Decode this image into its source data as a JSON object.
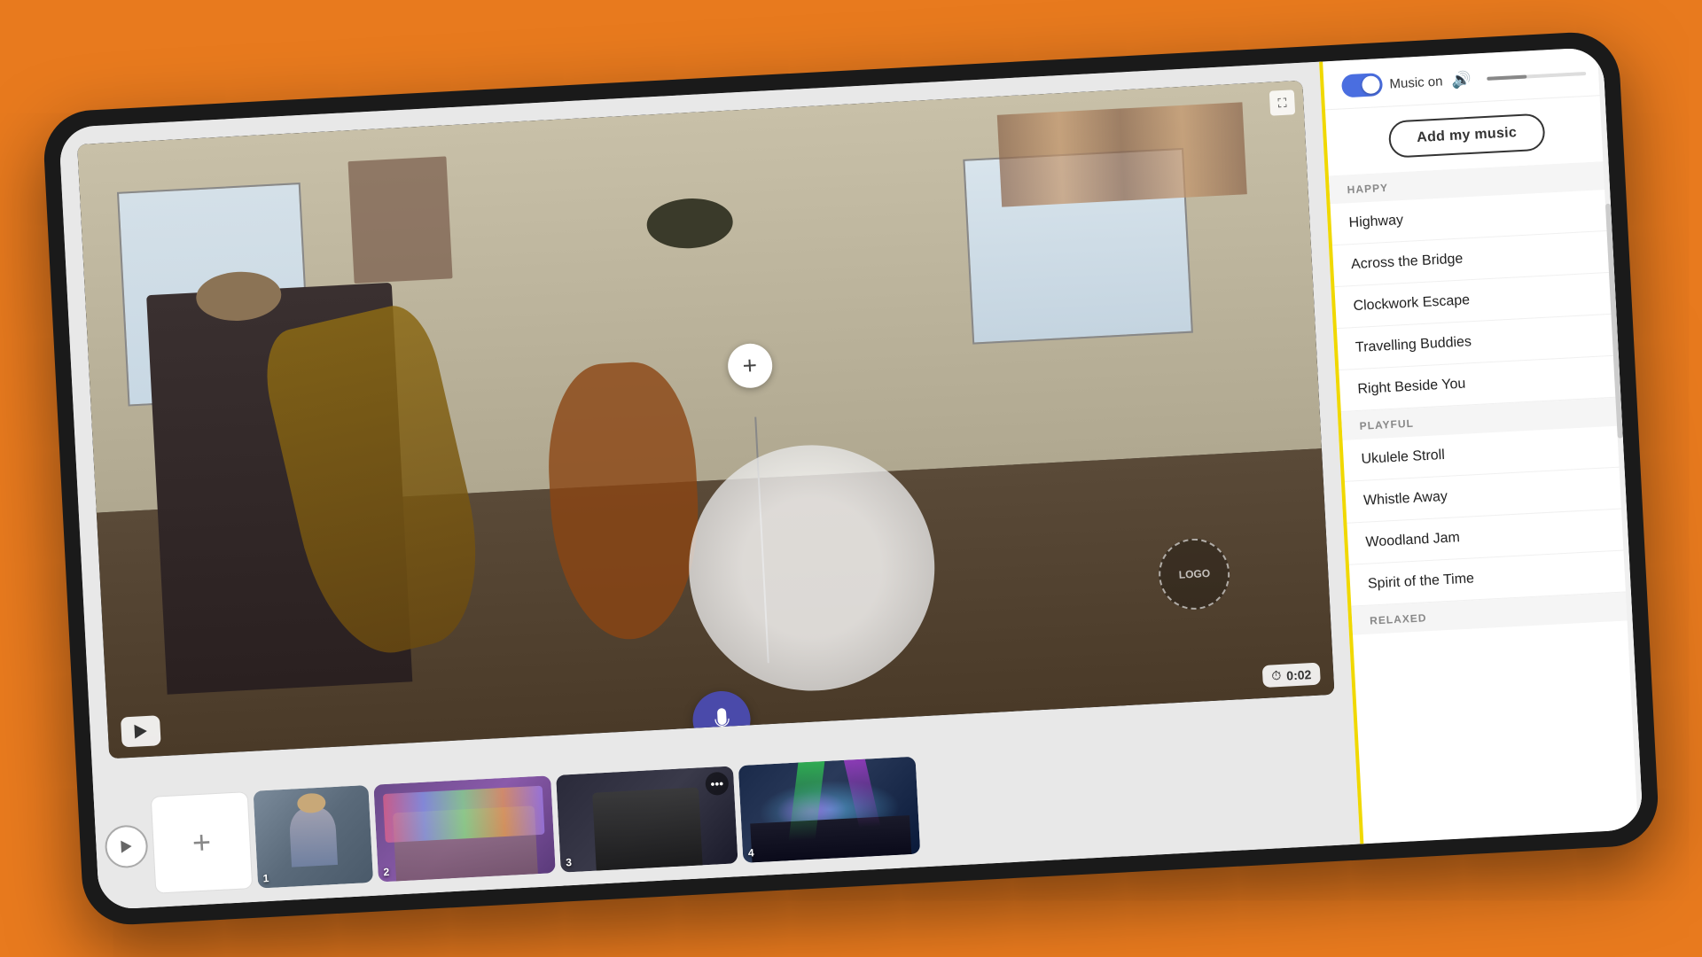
{
  "device": {
    "background_color": "#E87A1E"
  },
  "video": {
    "timer": "0:02",
    "timer_icon": "⏱",
    "logo_label": "LOGO",
    "play_label": "▶",
    "expand_icon": "⛶"
  },
  "toolbar": {
    "add_label": "+"
  },
  "thumbnails": [
    {
      "id": 1,
      "number": "1",
      "type": "band"
    },
    {
      "id": 2,
      "number": "2",
      "type": "ukulele"
    },
    {
      "id": 3,
      "number": "3",
      "type": "colorful"
    },
    {
      "id": 4,
      "number": "4",
      "type": "concert"
    }
  ],
  "music_panel": {
    "toggle_label": "Music on",
    "add_music_label": "Add my music",
    "volume_icon": "🔊",
    "categories": [
      {
        "name": "HAPPY",
        "items": [
          "Highway",
          "Across the Bridge",
          "Clockwork Escape",
          "Travelling Buddies",
          "Right Beside You"
        ]
      },
      {
        "name": "PLAYFUL",
        "items": [
          "Ukulele Stroll",
          "Whistle Away",
          "Woodland Jam",
          "Spirit of the Time"
        ]
      },
      {
        "name": "RELAXED",
        "items": []
      }
    ]
  }
}
